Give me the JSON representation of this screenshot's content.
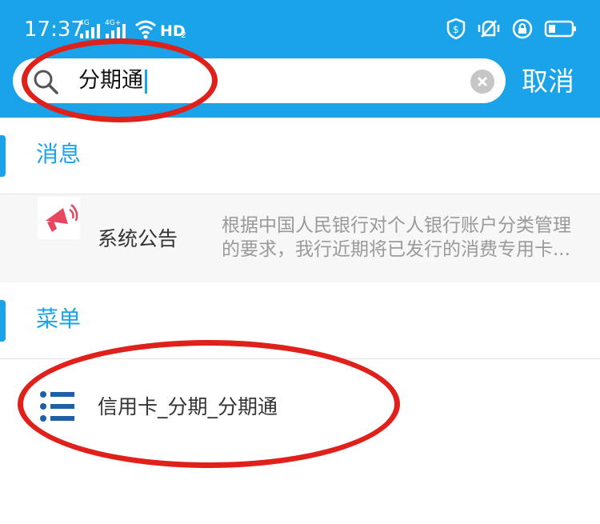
{
  "status_bar": {
    "time": "17:37",
    "net1": "4G",
    "net2": "4G+",
    "hd": "HD",
    "hd_sub": "2"
  },
  "search": {
    "query": "分期通",
    "cancel_label": "取消"
  },
  "sections": {
    "messages": {
      "title": "消息",
      "item": {
        "name": "系统公告",
        "line1": "根据中国人民银行对个人银行账户分类管理",
        "line2": "的要求，我行近期将已发行的消费专用卡..."
      }
    },
    "menu": {
      "title": "菜单",
      "item": {
        "label": "信用卡_分期_分期通"
      }
    }
  },
  "colors": {
    "brand": "#1aa3e8",
    "highlight": "#e0201b",
    "icon_red": "#e8475f",
    "menu_icon": "#1f5fa8"
  },
  "icons": [
    "search-icon",
    "clear-icon",
    "megaphone-icon",
    "list-icon",
    "shield-icon",
    "vibrate-icon",
    "lock-icon",
    "battery-icon"
  ]
}
